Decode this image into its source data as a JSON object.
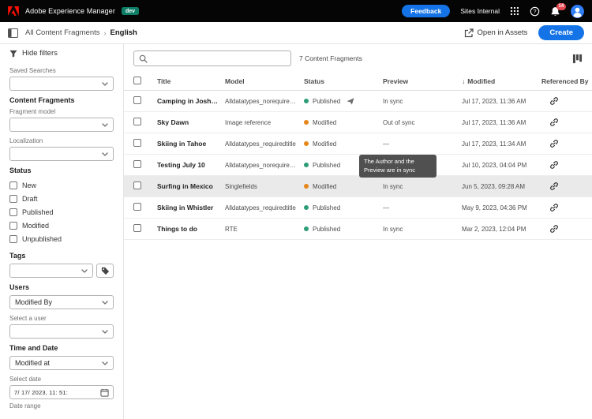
{
  "topbar": {
    "app_name": "Adobe Experience Manager",
    "env_badge": "dev",
    "feedback_label": "Feedback",
    "program_label": "Sites Internal",
    "notification_count": "14"
  },
  "nav": {
    "breadcrumb_root": "All Content Fragments",
    "breadcrumb_separator": "›",
    "breadcrumb_current": "English",
    "open_in_assets": "Open in Assets",
    "create_label": "Create"
  },
  "filters": {
    "hide_filters": "Hide filters",
    "saved_searches_label": "Saved Searches",
    "section_content_fragments": "Content Fragments",
    "fragment_model_label": "Fragment model",
    "localization_label": "Localization",
    "section_status": "Status",
    "status_options": [
      "New",
      "Draft",
      "Published",
      "Modified",
      "Unpublished"
    ],
    "section_tags": "Tags",
    "section_users": "Users",
    "modified_by_value": "Modified By",
    "select_user_label": "Select a user",
    "section_time_date": "Time and Date",
    "modified_at_value": "Modified at",
    "select_date_label": "Select date",
    "date_value": "7/ 17/ 2023,  11: 51:",
    "date_range_label": "Date range"
  },
  "search": {
    "value": ""
  },
  "toolbar": {
    "result_count": "7 Content Fragments"
  },
  "table": {
    "sort_indicator": "↓",
    "headers": {
      "title": "Title",
      "model": "Model",
      "status": "Status",
      "preview": "Preview",
      "modified": "Modified",
      "referenced_by": "Referenced By"
    },
    "rows": [
      {
        "title": "Camping in Joshua Tree",
        "model": "Alldatatypes_norequire…",
        "status": "Published",
        "status_color": "green",
        "extra_icon": "show",
        "preview": "In sync",
        "modified": "Jul 17, 2023, 11:36 AM"
      },
      {
        "title": "Sky Dawn",
        "model": "Image reference",
        "status": "Modified",
        "status_color": "orange",
        "preview": "Out of sync",
        "modified": "Jul 17, 2023, 11:36 AM"
      },
      {
        "title": "Skiing in Tahoe",
        "model": "Alldatatypes_requiredtitle",
        "status": "Modified",
        "status_color": "orange",
        "preview": "—",
        "modified": "Jul 17, 2023, 11:34 AM"
      },
      {
        "title": "Testing July 10",
        "model": "Alldatatypes_norequire…",
        "status": "Published",
        "status_color": "green",
        "preview": "",
        "modified": "Jul 10, 2023, 04:04 PM"
      },
      {
        "title": "Surfing in Mexico",
        "model": "Singlefields",
        "status": "Modified",
        "status_color": "orange",
        "preview": "In sync",
        "modified": "Jun 5, 2023, 09:28 AM",
        "row_class": "selected"
      },
      {
        "title": "Skiing in Whistler",
        "model": "Alldatatypes_requiredtitle",
        "status": "Published",
        "status_color": "green",
        "preview": "—",
        "modified": "May 9, 2023, 04:36 PM"
      },
      {
        "title": "Things to do",
        "model": "RTE",
        "status": "Published",
        "status_color": "green",
        "preview": "In sync",
        "modified": "Mar 2, 2023, 12:04 PM"
      }
    ]
  },
  "tooltip": {
    "text": "The Author and the Preview are in sync"
  },
  "colors": {
    "accent_blue": "#1473e6",
    "env_badge_bg": "#0d7d66",
    "status_green": "#2d9d78",
    "status_orange": "#e68619",
    "notification_red": "#e34850",
    "avatar_blue": "#2f7ef7",
    "tooltip_bg": "#505050",
    "adobe_red": "#fa0f00"
  }
}
